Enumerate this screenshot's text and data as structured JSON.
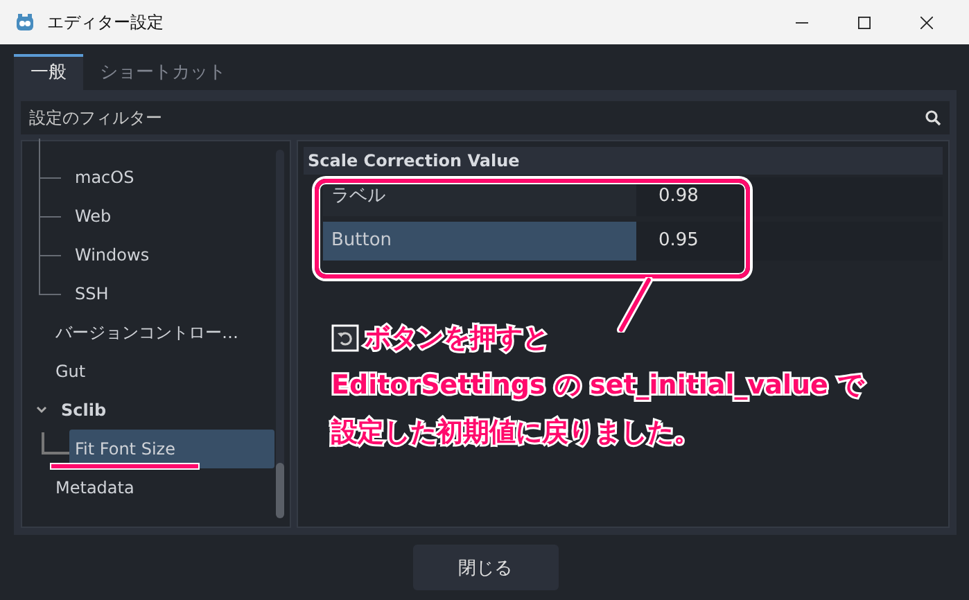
{
  "window": {
    "title": "エディター設定"
  },
  "tabs": [
    {
      "label": "一般",
      "selected": true
    },
    {
      "label": "ショートカット",
      "selected": false
    }
  ],
  "filter": {
    "placeholder": "設定のフィルター"
  },
  "sidebar": {
    "items": [
      {
        "label": "macOS",
        "tree_line": true
      },
      {
        "label": "Web",
        "tree_line": true
      },
      {
        "label": "Windows",
        "tree_line": true
      },
      {
        "label": "SSH",
        "tree_line": true
      },
      {
        "label": "バージョンコントロー…"
      },
      {
        "label": "Gut"
      },
      {
        "label": "Sclib",
        "expanded": true,
        "children": [
          {
            "label": "Fit Font Size",
            "selected": true
          }
        ]
      },
      {
        "label": "Metadata"
      }
    ]
  },
  "section": {
    "title": "Scale Correction Value",
    "rows": [
      {
        "label": "ラベル",
        "value": "0.98",
        "selected": false
      },
      {
        "label": "Button",
        "value": "0.95",
        "selected": true
      }
    ]
  },
  "annotation": {
    "lines": [
      "ボタンを押すと",
      "EditorSettings の set_initial_value で",
      "設定した初期値に戻りました。"
    ]
  },
  "buttons": [
    "閉じる"
  ]
}
